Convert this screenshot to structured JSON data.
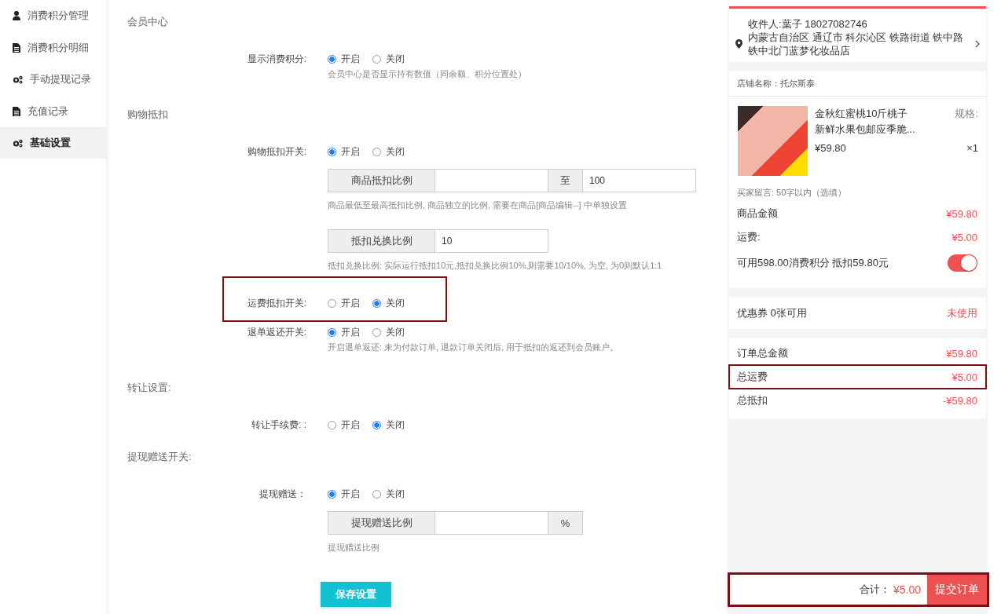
{
  "sidebar": {
    "items": [
      {
        "label": "消费积分管理",
        "kind": "user",
        "selected": false
      },
      {
        "label": "消费积分明细",
        "kind": "doc",
        "selected": false
      },
      {
        "label": "手动提现记录",
        "kind": "gears",
        "selected": false
      },
      {
        "label": "充值记录",
        "kind": "doc",
        "selected": false
      },
      {
        "label": "基础设置",
        "kind": "gears",
        "selected": true
      }
    ]
  },
  "settings": {
    "sections": [
      {
        "title": "会员中心",
        "rows": [
          {
            "label": "显示消费积分:",
            "options": [
              {
                "label": "开启",
                "selected": true
              },
              {
                "label": "关闭",
                "selected": false
              }
            ],
            "help": "会员中心是否显示持有数值（同余额、积分位置处）"
          }
        ]
      },
      {
        "title": "购物抵扣",
        "rows": [
          {
            "label": "购物抵扣开关:",
            "options": [
              {
                "label": "开启",
                "selected": true
              },
              {
                "label": "关闭",
                "selected": false
              }
            ],
            "groups": [
              {
                "parts": [
                  {
                    "kind": "addon",
                    "text": "商品抵扣比例"
                  },
                  {
                    "kind": "input"
                  },
                  {
                    "kind": "addon",
                    "text": "至"
                  },
                  {
                    "kind": "input",
                    "value": "100"
                  }
                ],
                "help": "商品最低至最高抵扣比例, 商品独立的比例, 需要在商品[商品编辑--] 中单独设置"
              },
              {
                "parts": [
                  {
                    "kind": "addon",
                    "text": "抵扣兑换比例"
                  },
                  {
                    "kind": "input",
                    "value": "10"
                  }
                ],
                "help": "抵扣兑换比例: 实际运行抵扣10元,抵扣兑换比例10%,则需要10/10%, 为空, 为0则默认1:1"
              }
            ]
          },
          {
            "label": "运费抵扣开关:",
            "highlighted": true,
            "options": [
              {
                "label": "开启",
                "selected": false
              },
              {
                "label": "关闭",
                "selected": true
              }
            ]
          },
          {
            "label": "退单返还开关:",
            "options": [
              {
                "label": "开启",
                "selected": true
              },
              {
                "label": "关闭",
                "selected": false
              }
            ],
            "help": "开启退单返还: 未为付款订单, 退款订单关闭后, 用于抵扣的返还到会员账户。"
          }
        ]
      },
      {
        "title": "转让设置:",
        "rows": [
          {
            "label": "转让手续费: :",
            "options": [
              {
                "label": "开启",
                "selected": false
              },
              {
                "label": "关闭",
                "selected": true
              }
            ]
          }
        ]
      },
      {
        "title": "提现赠送开关:",
        "rows": [
          {
            "label": "提现赠送：",
            "options": [
              {
                "label": "开启",
                "selected": true
              },
              {
                "label": "关闭",
                "selected": false
              }
            ],
            "groups": [
              {
                "parts": [
                  {
                    "kind": "addon",
                    "text": "提现赠送比例"
                  },
                  {
                    "kind": "input"
                  },
                  {
                    "kind": "addon",
                    "text": "%"
                  }
                ],
                "help": "提现赠送比例"
              }
            ]
          }
        ]
      }
    ],
    "save_button": "保存设置"
  },
  "order": {
    "recipient": "收件人:葉子 18027082746",
    "address": "内蒙古自治区 通辽市 科尔沁区 铁路街道 铁中路铁中北门蓝梦化妆品店",
    "store": "店铺名称：托尔斯泰",
    "product": {
      "title": "金秋红蜜桃10斤桃子新鲜水果包邮应季脆...",
      "spec": "规格:",
      "price": "¥59.80",
      "quantity": "×1"
    },
    "message": "买家留言: 50字以内（选填）",
    "lines": [
      {
        "label": "商品金额",
        "value": "¥59.80"
      },
      {
        "label": "运费:",
        "value": "¥5.00"
      }
    ],
    "points": {
      "label": "可用598.00消费积分 抵扣59.80元",
      "on": true
    },
    "coupon": {
      "label": "优惠券 0张可用",
      "value": "未使用"
    },
    "totals": [
      {
        "label": "订单总金额",
        "value": "¥59.80"
      },
      {
        "label": "总运费",
        "value": "¥5.00",
        "highlighted": true
      },
      {
        "label": "总抵扣",
        "value": "-¥59.80"
      }
    ],
    "footer": {
      "label": "合计：",
      "amount": "¥5.00",
      "button": "提交订单",
      "highlighted": true
    }
  }
}
